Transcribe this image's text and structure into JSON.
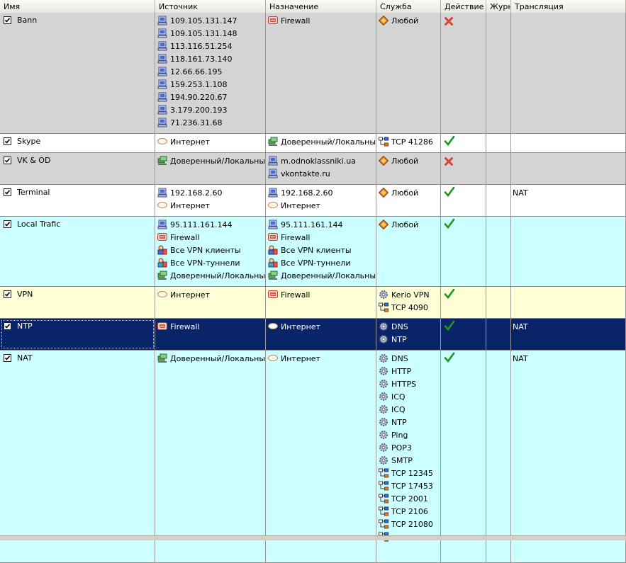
{
  "columns": [
    "Имя",
    "Источник",
    "Назначение",
    "Служба",
    "Действие",
    "Журн",
    "Трансляция"
  ],
  "colors": {
    "selected_bg": "#0a246a",
    "gray_row": "#d4d4d4",
    "white_row": "#ffffff",
    "cyan_row": "#ccffff",
    "yellow_row": "#ffffd6",
    "allow_check": "#1a9a1a",
    "deny_x": "#d8423a"
  },
  "rows": [
    {
      "name": "Bann",
      "checked": true,
      "bg": "gray",
      "source": [
        {
          "icon": "computer-icon",
          "text": "109.105.131.147"
        },
        {
          "icon": "computer-icon",
          "text": "109.105.131.148"
        },
        {
          "icon": "computer-icon",
          "text": "113.116.51.254"
        },
        {
          "icon": "computer-icon",
          "text": "118.161.73.140"
        },
        {
          "icon": "computer-icon",
          "text": "12.66.66.195"
        },
        {
          "icon": "computer-icon",
          "text": "159.253.1.108"
        },
        {
          "icon": "computer-icon",
          "text": "194.90.220.67"
        },
        {
          "icon": "computer-icon",
          "text": "3.179.200.193"
        },
        {
          "icon": "computer-icon",
          "text": "71.236.31.68"
        }
      ],
      "dest": [
        {
          "icon": "firewall-icon",
          "text": "Firewall"
        }
      ],
      "service": [
        {
          "icon": "any-icon",
          "text": "Любой"
        }
      ],
      "action": "deny",
      "log": "",
      "translation": ""
    },
    {
      "name": "Skype",
      "checked": true,
      "bg": "white",
      "source": [
        {
          "icon": "internet-icon",
          "text": "Интернет"
        }
      ],
      "dest": [
        {
          "icon": "trusted-network-icon",
          "text": "Доверенный/Локальный"
        }
      ],
      "service": [
        {
          "icon": "tcp-port-icon",
          "text": "TCP 41286"
        }
      ],
      "action": "allow",
      "log": "",
      "translation": ""
    },
    {
      "name": "VK & OD",
      "checked": true,
      "bg": "gray",
      "source": [
        {
          "icon": "trusted-network-icon",
          "text": "Доверенный/Локальный"
        }
      ],
      "dest": [
        {
          "icon": "computer-icon",
          "text": "m.odnoklassniki.ua"
        },
        {
          "icon": "computer-icon",
          "text": "vkontakte.ru"
        }
      ],
      "service": [
        {
          "icon": "any-icon",
          "text": "Любой"
        }
      ],
      "action": "deny",
      "log": "",
      "translation": ""
    },
    {
      "name": "Terminal",
      "checked": true,
      "bg": "white",
      "source": [
        {
          "icon": "computer-icon",
          "text": "192.168.2.60"
        },
        {
          "icon": "internet-icon",
          "text": "Интернет"
        }
      ],
      "dest": [
        {
          "icon": "computer-icon",
          "text": "192.168.2.60"
        },
        {
          "icon": "internet-icon",
          "text": "Интернет"
        }
      ],
      "service": [
        {
          "icon": "any-icon",
          "text": "Любой"
        }
      ],
      "action": "allow",
      "log": "",
      "translation": "NAT"
    },
    {
      "name": "Local Trafic",
      "checked": true,
      "bg": "cyan",
      "source": [
        {
          "icon": "computer-icon",
          "text": "95.111.161.144"
        },
        {
          "icon": "firewall-icon",
          "text": "Firewall"
        },
        {
          "icon": "vpn-clients-icon",
          "text": "Все VPN клиенты"
        },
        {
          "icon": "vpn-tunnels-icon",
          "text": "Все VPN-туннели"
        },
        {
          "icon": "trusted-network-icon",
          "text": "Доверенный/Локальный"
        }
      ],
      "dest": [
        {
          "icon": "computer-icon",
          "text": "95.111.161.144"
        },
        {
          "icon": "firewall-icon",
          "text": "Firewall"
        },
        {
          "icon": "vpn-clients-icon",
          "text": "Все VPN клиенты"
        },
        {
          "icon": "vpn-tunnels-icon",
          "text": "Все VPN-туннели"
        },
        {
          "icon": "trusted-network-icon",
          "text": "Доверенный/Локальный"
        }
      ],
      "service": [
        {
          "icon": "any-icon",
          "text": "Любой"
        }
      ],
      "action": "allow",
      "log": "",
      "translation": ""
    },
    {
      "name": "VPN",
      "checked": true,
      "bg": "yellow",
      "source": [
        {
          "icon": "internet-icon",
          "text": "Интернет"
        }
      ],
      "dest": [
        {
          "icon": "firewall-icon",
          "text": "Firewall"
        }
      ],
      "service": [
        {
          "icon": "service-gear-icon",
          "text": "Kerio VPN"
        },
        {
          "icon": "tcp-port-icon",
          "text": "TCP 4090"
        }
      ],
      "action": "allow",
      "log": "",
      "translation": ""
    },
    {
      "name": "NTP",
      "checked": true,
      "bg": "selected",
      "selected": true,
      "source": [
        {
          "icon": "firewall-icon",
          "text": "Firewall"
        }
      ],
      "dest": [
        {
          "icon": "internet-icon",
          "text": "Интернет"
        }
      ],
      "service": [
        {
          "icon": "service-gear-icon",
          "text": "DNS"
        },
        {
          "icon": "service-gear-icon",
          "text": "NTP"
        }
      ],
      "action": "allow",
      "log": "",
      "translation": "NAT"
    },
    {
      "name": "NAT",
      "checked": true,
      "bg": "cyan",
      "source": [
        {
          "icon": "trusted-network-icon",
          "text": "Доверенный/Локальный"
        }
      ],
      "dest": [
        {
          "icon": "internet-icon",
          "text": "Интернет"
        }
      ],
      "service": [
        {
          "icon": "service-gear-icon",
          "text": "DNS"
        },
        {
          "icon": "service-gear-icon",
          "text": "HTTP"
        },
        {
          "icon": "service-gear-icon",
          "text": "HTTPS"
        },
        {
          "icon": "service-gear-icon",
          "text": "ICQ"
        },
        {
          "icon": "service-gear-icon",
          "text": "ICQ"
        },
        {
          "icon": "service-gear-icon",
          "text": "NTP"
        },
        {
          "icon": "service-gear-icon",
          "text": "Ping"
        },
        {
          "icon": "service-gear-icon",
          "text": "POP3"
        },
        {
          "icon": "service-gear-icon",
          "text": "SMTP"
        },
        {
          "icon": "tcp-port-icon",
          "text": "TCP 12345"
        },
        {
          "icon": "tcp-port-icon",
          "text": "TCP 17453"
        },
        {
          "icon": "tcp-port-icon",
          "text": "TCP 2001"
        },
        {
          "icon": "tcp-port-icon",
          "text": "TCP 2106"
        },
        {
          "icon": "tcp-port-icon",
          "text": "TCP 21080"
        },
        {
          "icon": "tcp-port-icon",
          "text": ""
        }
      ],
      "action": "allow",
      "log": "",
      "translation": "NAT"
    }
  ]
}
